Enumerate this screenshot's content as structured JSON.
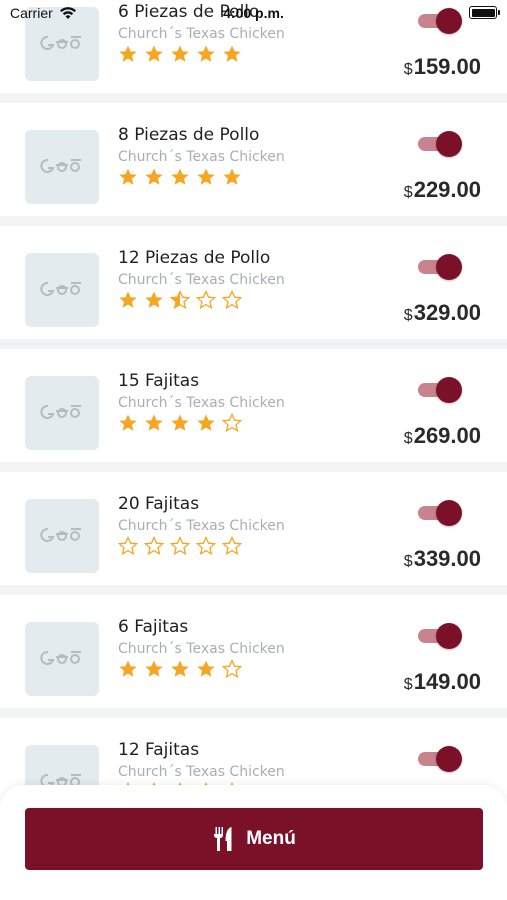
{
  "status_bar": {
    "carrier": "Carrier",
    "time": "4:00 p.m."
  },
  "colors": {
    "accent": "#7b1128",
    "toggle_track": "#c9838f",
    "star": "#f5a623"
  },
  "items": [
    {
      "name": "6 Piezas de Pollo",
      "vendor": "Church´s Texas Chicken",
      "rating": 5,
      "currency": "$",
      "price": "159.00",
      "enabled": true
    },
    {
      "name": "8 Piezas de Pollo",
      "vendor": "Church´s Texas Chicken",
      "rating": 5,
      "currency": "$",
      "price": "229.00",
      "enabled": true
    },
    {
      "name": "12 Piezas de Pollo",
      "vendor": "Church´s Texas Chicken",
      "rating": 2.5,
      "currency": "$",
      "price": "329.00",
      "enabled": true
    },
    {
      "name": "15 Fajitas",
      "vendor": "Church´s Texas Chicken",
      "rating": 4,
      "currency": "$",
      "price": "269.00",
      "enabled": true
    },
    {
      "name": "20 Fajitas",
      "vendor": "Church´s Texas Chicken",
      "rating": 0,
      "currency": "$",
      "price": "339.00",
      "enabled": true
    },
    {
      "name": "6 Fajitas",
      "vendor": "Church´s Texas Chicken",
      "rating": 4,
      "currency": "$",
      "price": "149.00",
      "enabled": true
    },
    {
      "name": "12 Fajitas",
      "vendor": "Church´s Texas Chicken",
      "rating": 0,
      "currency": "$",
      "price": "",
      "enabled": true
    }
  ],
  "bottom": {
    "menu_label": "Menú",
    "menu_icon": "fork-knife-icon"
  }
}
